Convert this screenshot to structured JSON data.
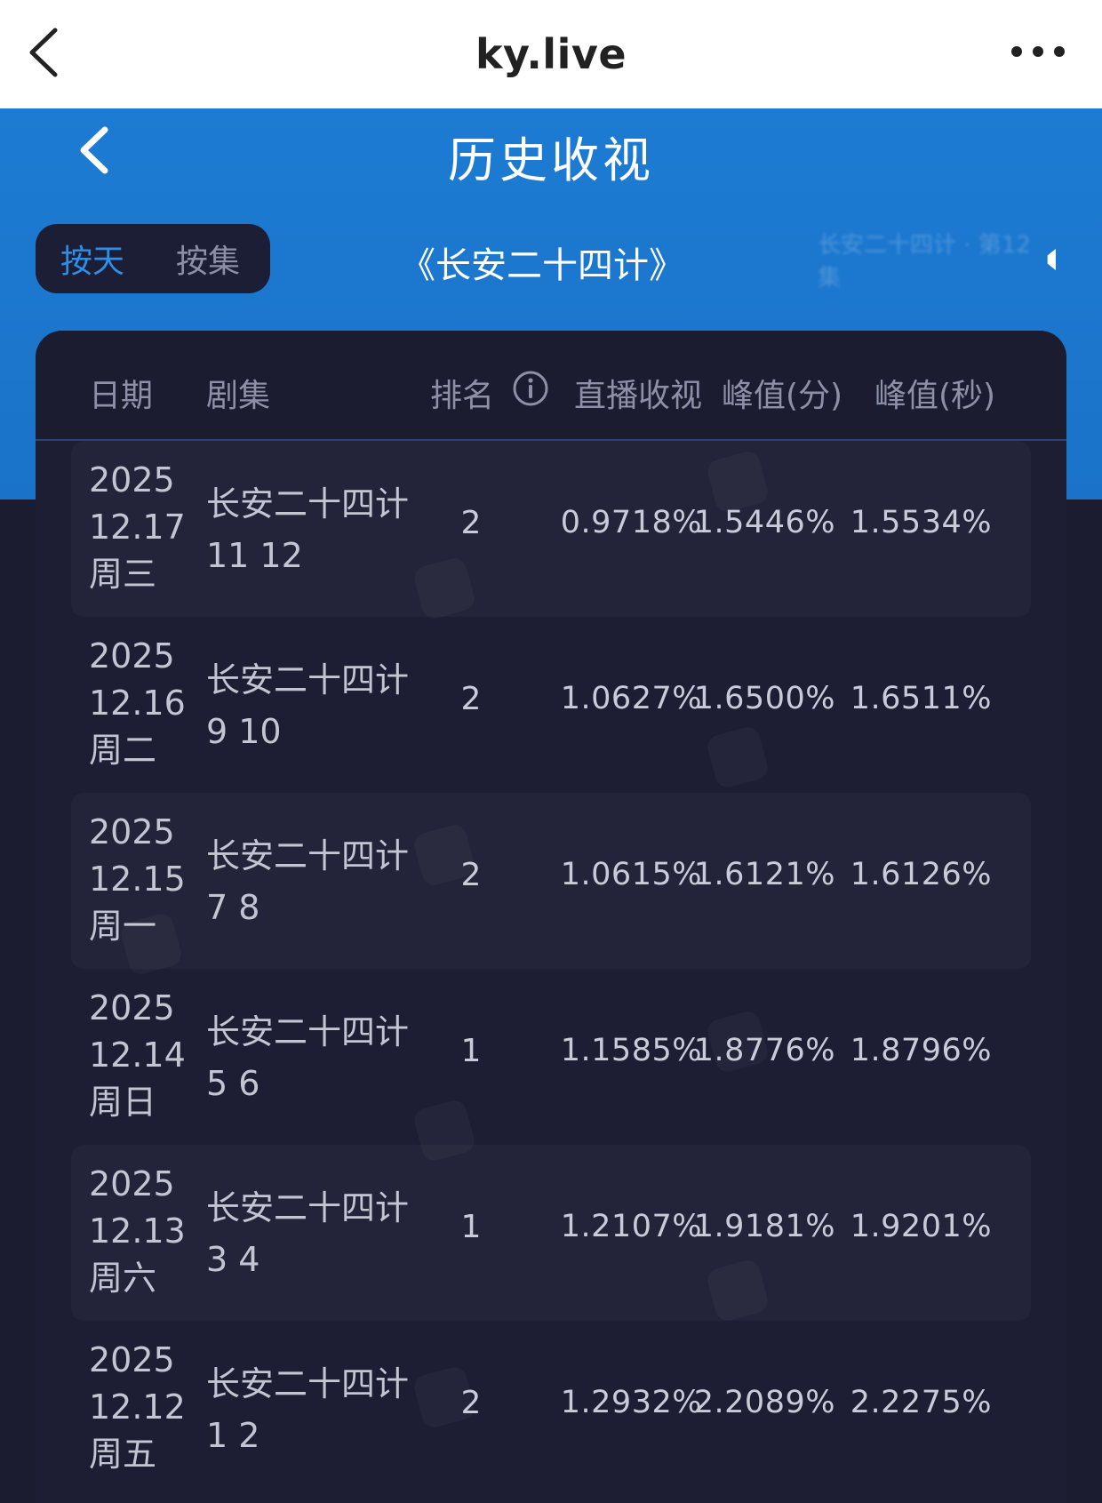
{
  "browser": {
    "title": "ky.live",
    "back_icon": "chevron-left-icon",
    "more_icon": "more-horizontal-icon"
  },
  "header": {
    "title": "历史收视",
    "back_icon": "chevron-left-icon"
  },
  "toggle": {
    "by_day": "按天",
    "by_episode": "按集",
    "active": "by_day"
  },
  "drama_title": "《长安二十四计》",
  "marquee_text": "长安二十四计 · 第12集",
  "table": {
    "headers": {
      "date": "日期",
      "episode": "剧集",
      "rank": "排名",
      "live_rating": "直播收视",
      "peak_min": "峰值(分)",
      "peak_sec": "峰值(秒)"
    },
    "rows": [
      {
        "year": "2025",
        "date": "12.17",
        "weekday": "周三",
        "drama": "长安二十四计",
        "episodes": "11 12",
        "rank": "2",
        "live": "0.9718%",
        "peak_min": "1.5446%",
        "peak_sec": "1.5534%"
      },
      {
        "year": "2025",
        "date": "12.16",
        "weekday": "周二",
        "drama": "长安二十四计",
        "episodes": "9 10",
        "rank": "2",
        "live": "1.0627%",
        "peak_min": "1.6500%",
        "peak_sec": "1.6511%"
      },
      {
        "year": "2025",
        "date": "12.15",
        "weekday": "周一",
        "drama": "长安二十四计",
        "episodes": "7 8",
        "rank": "2",
        "live": "1.0615%",
        "peak_min": "1.6121%",
        "peak_sec": "1.6126%"
      },
      {
        "year": "2025",
        "date": "12.14",
        "weekday": "周日",
        "drama": "长安二十四计",
        "episodes": "5 6",
        "rank": "1",
        "live": "1.1585%",
        "peak_min": "1.8776%",
        "peak_sec": "1.8796%"
      },
      {
        "year": "2025",
        "date": "12.13",
        "weekday": "周六",
        "drama": "长安二十四计",
        "episodes": "3 4",
        "rank": "1",
        "live": "1.2107%",
        "peak_min": "1.9181%",
        "peak_sec": "1.9201%"
      },
      {
        "year": "2025",
        "date": "12.12",
        "weekday": "周五",
        "drama": "长安二十四计",
        "episodes": "1 2",
        "rank": "2",
        "live": "1.2932%",
        "peak_min": "2.2089%",
        "peak_sec": "2.2275%"
      }
    ]
  },
  "colors": {
    "header_blue": "#1d7bd3",
    "background": "#1b1c30",
    "active_tab": "#2f8fe6",
    "text_primary": "#c9cbd8",
    "text_muted": "#8d90a6"
  }
}
